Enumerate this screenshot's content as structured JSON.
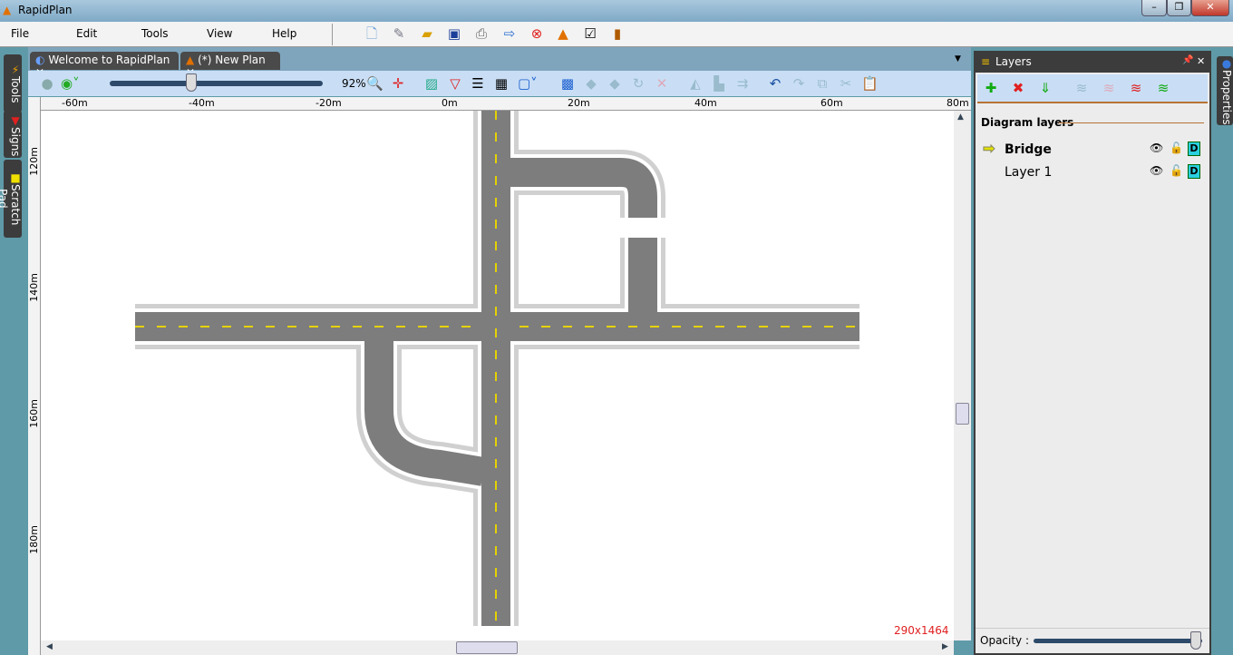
{
  "window": {
    "title": "RapidPlan",
    "controls": [
      "minimize",
      "maximize",
      "close"
    ]
  },
  "menu": [
    "File",
    "Edit",
    "Tools",
    "View",
    "Help"
  ],
  "main_toolbar_icons": [
    "new-file-icon",
    "edit-file-icon",
    "open-folder-icon",
    "save-icon",
    "print-icon",
    "export-icon",
    "close-red-icon",
    "cone-icon",
    "checkbox-icon",
    "exit-door-icon"
  ],
  "tabs": [
    {
      "label": "Welcome to RapidPlan",
      "icon": "rapidplan-logo-icon"
    },
    {
      "label": "(*) New Plan",
      "icon": "traffic-cone-icon"
    }
  ],
  "view_toolbar": {
    "zoom_percent": "92%",
    "zoom_level": 0.27
  },
  "ruler_top": [
    "-60m",
    "-40m",
    "-20m",
    "0m",
    "20m",
    "40m",
    "60m",
    "80m"
  ],
  "ruler_left": [
    "120m",
    "140m",
    "160m",
    "180m"
  ],
  "canvas": {
    "size_label": "290x1464",
    "road_color": "#7d7d7d",
    "lane_mark_color": "#e6d200"
  },
  "side_tabs": [
    "Tools",
    "Signs",
    "Scratch Pad"
  ],
  "layers_panel": {
    "title": "Layers",
    "section": "Diagram layers",
    "layers": [
      {
        "name": "Bridge",
        "active": true
      },
      {
        "name": "Layer 1",
        "active": false
      }
    ],
    "opacity_label": "Opacity :",
    "opacity": 1.0
  },
  "properties_tab": "Properties"
}
